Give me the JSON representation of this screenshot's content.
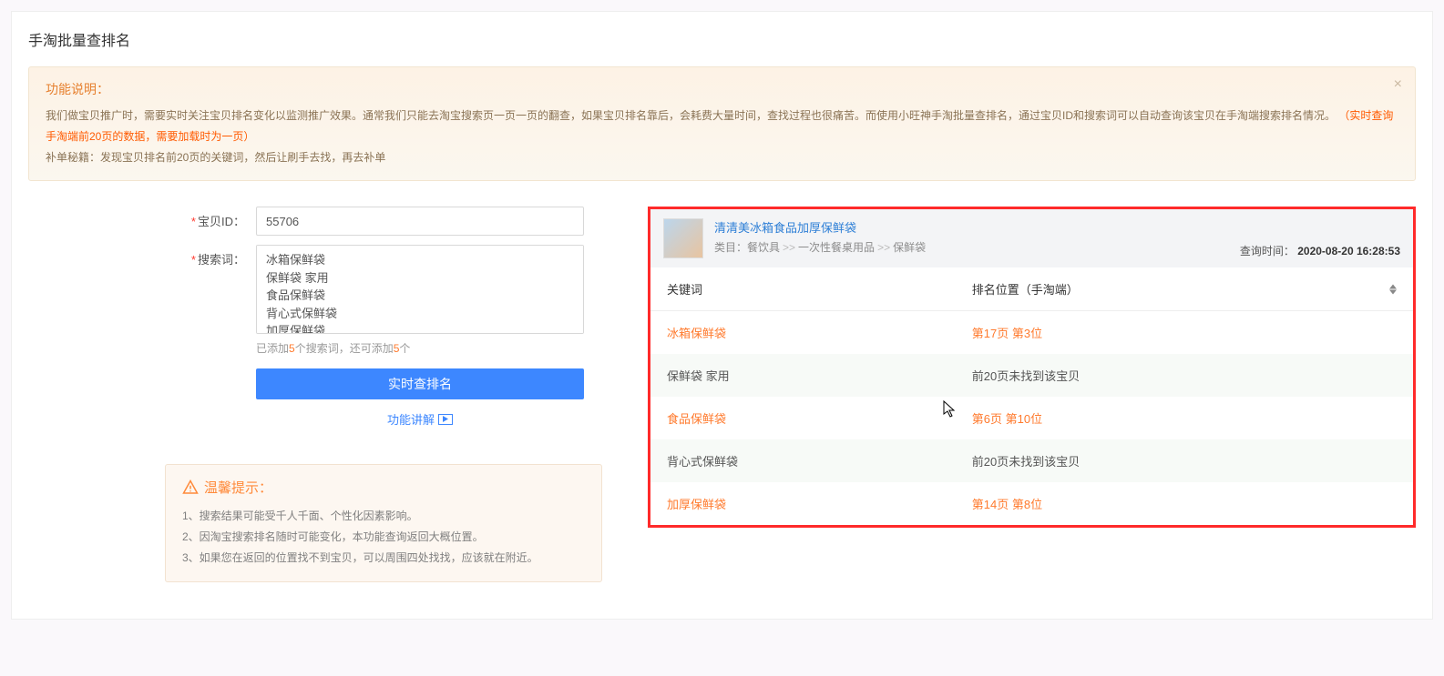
{
  "page": {
    "title": "手淘批量查排名"
  },
  "info": {
    "title": "功能说明：",
    "line1_pre": "我们做宝贝推广时，需要实时关注宝贝排名变化以监测推广效果。通常我们只能去淘宝搜索页一页一页的翻查，如果宝贝排名靠后，会耗费大量时间，查找过程也很痛苦。而使用小旺神手淘批量查排名，通过宝贝ID和搜索词可以自动查询该宝贝在手淘端搜索排名情况。",
    "line1_highlight": "（实时查询手淘端前20页的数据，需要加载时为一页）",
    "line2": "补单秘籍：发现宝贝排名前20页的关键词，然后让刷手去找，再去补单"
  },
  "form": {
    "id_label": "宝贝ID：",
    "id_value": "55706",
    "kw_label": "搜索词：",
    "kw_value": "冰箱保鲜袋\n保鲜袋 家用\n食品保鲜袋\n背心式保鲜袋\n加厚保鲜袋",
    "helper_pre": "已添加",
    "helper_count": "5",
    "helper_mid": "个搜索词，还可添加",
    "helper_remain": "5",
    "helper_suf": "个",
    "submit_label": "实时查排名",
    "help_link_label": "功能讲解"
  },
  "tips": {
    "header": "温馨提示：",
    "items": [
      "1、搜索结果可能受千人千面、个性化因素影响。",
      "2、因淘宝搜索排名随时可能变化，本功能查询返回大概位置。",
      "3、如果您在返回的位置找不到宝贝，可以周围四处找找，应该就在附近。"
    ]
  },
  "result": {
    "product_title": "清清美冰箱食品加厚保鲜袋",
    "category_label": "类目：",
    "category_path": [
      "餐饮具",
      "一次性餐桌用品",
      "保鲜袋"
    ],
    "time_label": "查询时间：",
    "time_value": "2020-08-20 16:28:53",
    "col_keyword": "关键词",
    "col_position": "排名位置（手淘端）",
    "rows": [
      {
        "keyword": "冰箱保鲜袋",
        "position": "第17页 第3位",
        "found": true
      },
      {
        "keyword": "保鲜袋 家用",
        "position": "前20页未找到该宝贝",
        "found": false
      },
      {
        "keyword": "食品保鲜袋",
        "position": "第6页 第10位",
        "found": true
      },
      {
        "keyword": "背心式保鲜袋",
        "position": "前20页未找到该宝贝",
        "found": false
      },
      {
        "keyword": "加厚保鲜袋",
        "position": "第14页 第8位",
        "found": true
      }
    ]
  }
}
